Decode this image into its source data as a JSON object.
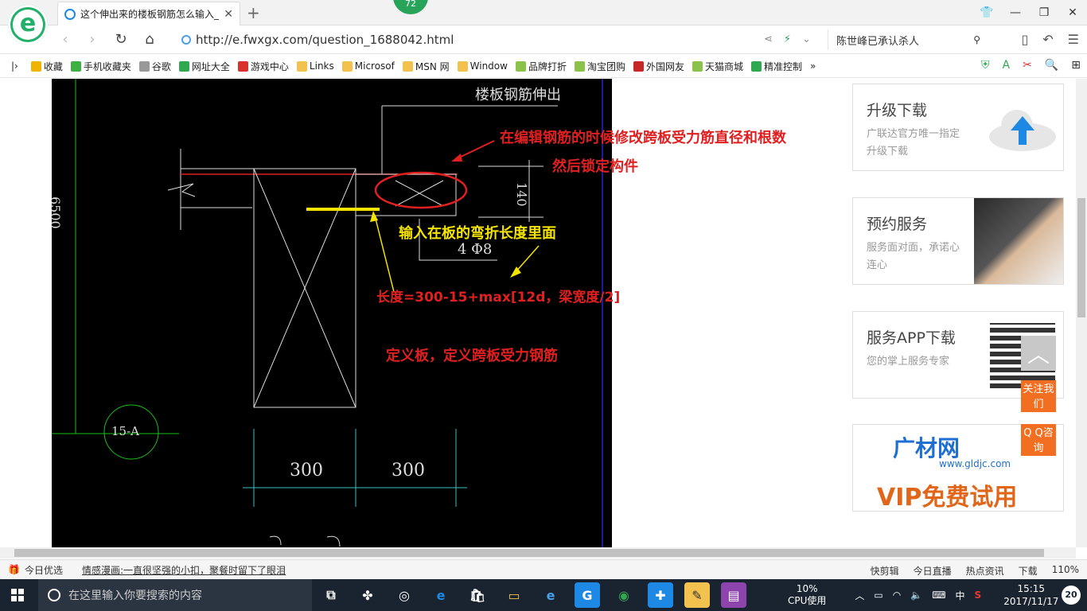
{
  "browser": {
    "tab_title": "这个伸出来的楼板钢筋怎么输入_",
    "notification_count": "72",
    "url": "http://e.fwxgx.com/question_1688042.html",
    "search_query": "陈世峰已承认杀人"
  },
  "bookmarks": [
    {
      "label": "收藏",
      "icon": "star-icon",
      "color": "#f0b400"
    },
    {
      "label": "手机收藏夹",
      "icon": "phone-icon",
      "color": "#3cb043"
    },
    {
      "label": "谷歌",
      "icon": "page-icon",
      "color": "#999999"
    },
    {
      "label": "网址大全",
      "icon": "globe-icon",
      "color": "#2fa84f"
    },
    {
      "label": "游戏中心",
      "icon": "game-icon",
      "color": "#d9302c"
    },
    {
      "label": "Links",
      "icon": "folder-icon",
      "color": "#f2c14e"
    },
    {
      "label": "Microsof",
      "icon": "folder-icon",
      "color": "#f2c14e"
    },
    {
      "label": "MSN 网",
      "icon": "folder-icon",
      "color": "#f2c14e"
    },
    {
      "label": "Window",
      "icon": "folder-icon",
      "color": "#f2c14e"
    },
    {
      "label": "品牌打折",
      "icon": "leaf-icon",
      "color": "#8bc34a"
    },
    {
      "label": "淘宝团购",
      "icon": "leaf-icon",
      "color": "#8bc34a"
    },
    {
      "label": "外国网友",
      "icon": "bookmark-icon",
      "color": "#c62828"
    },
    {
      "label": "天猫商城",
      "icon": "leaf-icon",
      "color": "#8bc34a"
    },
    {
      "label": "精准控制",
      "icon": "wechat-icon",
      "color": "#2fa84f"
    }
  ],
  "drawing": {
    "title": "楼板钢筋伸出",
    "dim_vertical": "6500",
    "dim_slab": "140",
    "rebar": "4 Φ8",
    "axis": "15-A",
    "span1": "300",
    "span2": "300"
  },
  "annotations": {
    "red1": "在编辑钢筋的时候修改跨板受力筋直径和根数",
    "red2": "然后锁定构件",
    "yellow": "输入在板的弯折长度里面",
    "formula": "长度=300-15+max[12d，梁宽度/2]",
    "red3": "定义板，定义跨板受力钢筋"
  },
  "sidebar": [
    {
      "heading": "升级下载",
      "desc": "广联达官方唯一指定升级下载",
      "icon": "cloud-upload-icon"
    },
    {
      "heading": "预约服务",
      "desc": "服务面对面，承诺心连心",
      "icon": "handshake-icon"
    },
    {
      "heading": "服务APP下载",
      "desc": "您的掌上服务专家",
      "icon": "qr-code-icon"
    }
  ],
  "ad": {
    "brand": "广材网",
    "url": "www.gldjc.com",
    "slogan": "VIP免费试用"
  },
  "float": {
    "follow": "关注我们",
    "qq": "Q Q咨询"
  },
  "statusbar": {
    "left": "今日优选",
    "news": "情感漫画:一直很坚强的小扣，聚餐时留下了眼泪",
    "items": [
      "快剪辑",
      "今日直播",
      "热点资讯",
      "下载"
    ],
    "zoom": "110%"
  },
  "taskbar": {
    "search_placeholder": "在这里输入你要搜索的内容",
    "cpu_percent": "10%",
    "cpu_label": "CPU使用",
    "ime": "中",
    "time": "15:15",
    "date": "2017/11/17",
    "notifications": "20"
  }
}
